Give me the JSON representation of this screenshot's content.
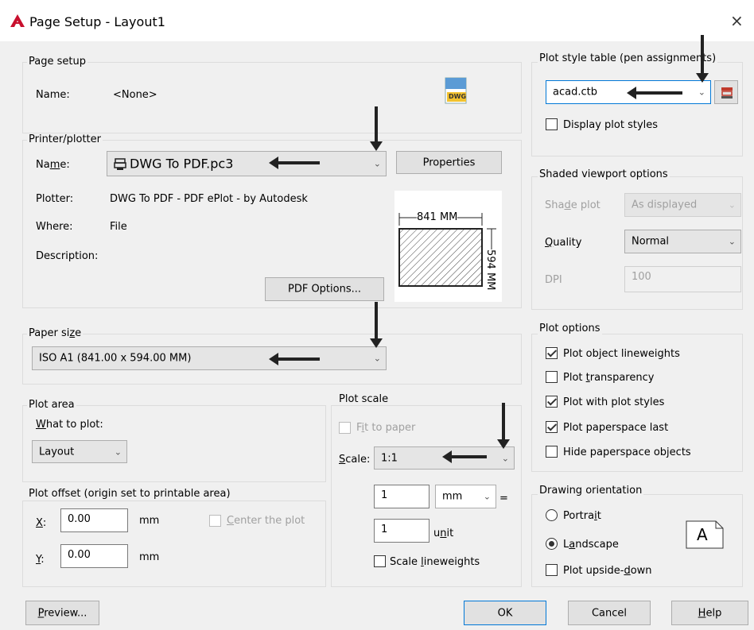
{
  "window": {
    "title": "Page Setup - Layout1",
    "close": "×"
  },
  "page_setup": {
    "label": "Page setup",
    "name_label": "Name:",
    "name_value": "<None>",
    "icon_text": "DWG"
  },
  "printer": {
    "label": "Printer/plotter",
    "name_label": "Name:",
    "name_value": "DWG To PDF.pc3",
    "properties_button": "Properties",
    "plotter_label": "Plotter:",
    "plotter_value": "DWG To PDF - PDF ePlot - by Autodesk",
    "where_label": "Where:",
    "where_value": "File",
    "description_label": "Description:",
    "pdf_options_button": "PDF Options...",
    "preview": {
      "width_text": "841  MM",
      "height_text": "594  MM"
    }
  },
  "paper_size": {
    "label": "Paper size",
    "value": "ISO A1 (841.00 x 594.00 MM)"
  },
  "plot_area": {
    "label": "Plot area",
    "what_to_plot_label": "What to plot:",
    "what_to_plot_value": "Layout"
  },
  "plot_offset": {
    "label": "Plot offset (origin set to printable area)",
    "x_label": "X:",
    "x_value": "0.00",
    "x_unit": "mm",
    "y_label": "Y:",
    "y_value": "0.00",
    "y_unit": "mm",
    "center_label": "Center the plot"
  },
  "plot_scale": {
    "label": "Plot scale",
    "fit_label": "Fit to paper",
    "scale_label": "Scale:",
    "scale_value": "1:1",
    "value1": "1",
    "unit1": "mm",
    "equals": "=",
    "value2": "1",
    "unit2": "unit",
    "scale_lineweights": "Scale lineweights"
  },
  "plot_style_table": {
    "label": "Plot style table (pen assignments)",
    "value": "acad.ctb",
    "display_label": "Display plot styles"
  },
  "shaded_viewport": {
    "label": "Shaded viewport options",
    "shade_plot_label": "Shade plot",
    "shade_plot_value": "As displayed",
    "quality_label": "Quality",
    "quality_value": "Normal",
    "dpi_label": "DPI",
    "dpi_value": "100"
  },
  "plot_options": {
    "label": "Plot options",
    "items": [
      {
        "label": "Plot object lineweights",
        "checked": true
      },
      {
        "label": "Plot transparency",
        "checked": false
      },
      {
        "label": "Plot with plot styles",
        "checked": true
      },
      {
        "label": "Plot paperspace last",
        "checked": true
      },
      {
        "label": "Hide paperspace objects",
        "checked": false
      }
    ]
  },
  "drawing_orientation": {
    "label": "Drawing orientation",
    "portrait": "Portrait",
    "landscape": "Landscape",
    "upside_down": "Plot upside-down",
    "icon_letter": "A"
  },
  "footer": {
    "preview": "Preview...",
    "ok": "OK",
    "cancel": "Cancel",
    "help": "Help"
  },
  "colors": {
    "accent": "#0078d7",
    "app_red": "#c8102e"
  }
}
